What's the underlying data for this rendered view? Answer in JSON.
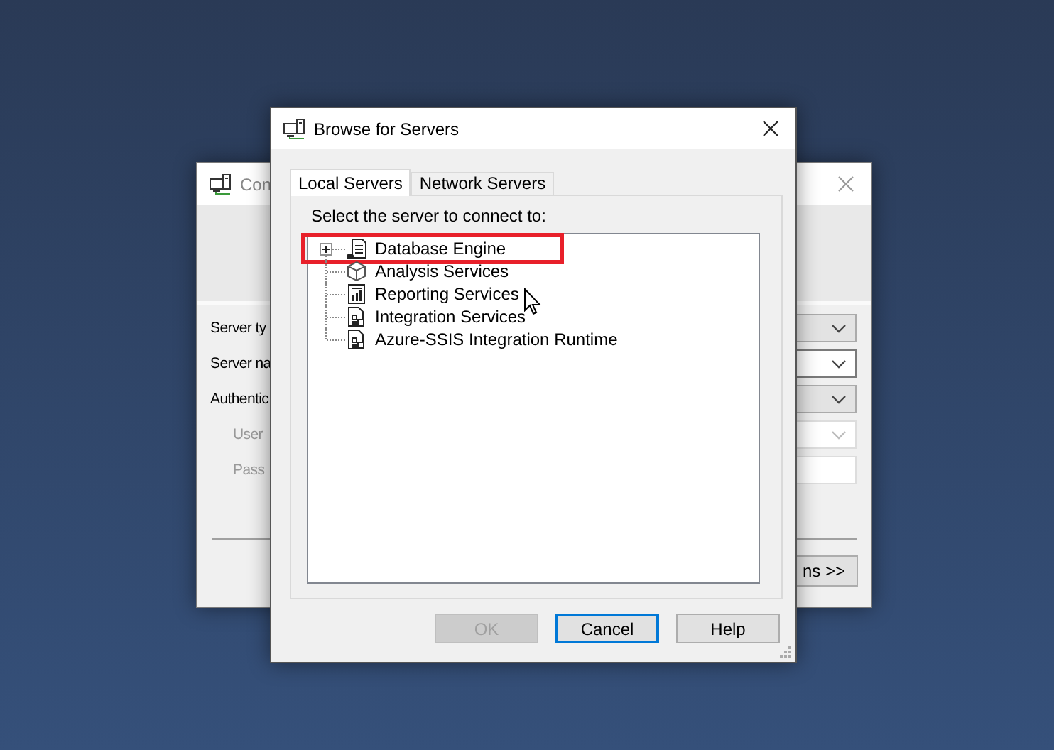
{
  "background_window": {
    "title": "Con",
    "labels": [
      {
        "text": "Server ty",
        "disabled": false
      },
      {
        "text": "Server na",
        "disabled": false
      },
      {
        "text": "Authentic",
        "disabled": false
      },
      {
        "text": "User",
        "disabled": true
      },
      {
        "text": "Pass",
        "disabled": true
      }
    ],
    "fields": [
      {
        "kind": "dropdown",
        "disabled": false
      },
      {
        "kind": "editable-dropdown",
        "disabled": false
      },
      {
        "kind": "dropdown",
        "disabled": false
      },
      {
        "kind": "editable-dropdown",
        "disabled": true
      },
      {
        "kind": "textbox",
        "disabled": true
      }
    ],
    "button": "ns >>"
  },
  "dialog": {
    "title": "Browse for Servers",
    "tabs": [
      {
        "label": "Local Servers",
        "selected": true
      },
      {
        "label": "Network Servers",
        "selected": false
      }
    ],
    "prompt": "Select the server to connect to:",
    "tree": [
      {
        "label": "Database Engine",
        "kind": "database",
        "expanded": false,
        "expandable": true,
        "highlighted": true
      },
      {
        "label": "Analysis Services",
        "kind": "cube",
        "expandable": false,
        "highlighted": false
      },
      {
        "label": "Reporting Services",
        "kind": "report",
        "expandable": false,
        "highlighted": false
      },
      {
        "label": "Integration Services",
        "kind": "package",
        "expandable": false,
        "highlighted": false
      },
      {
        "label": "Azure-SSIS Integration Runtime",
        "kind": "package",
        "expandable": false,
        "highlighted": false
      }
    ],
    "buttons": [
      {
        "label": "OK",
        "disabled": true,
        "focused": false
      },
      {
        "label": "Cancel",
        "disabled": false,
        "focused": true
      },
      {
        "label": "Help",
        "disabled": false,
        "focused": false
      }
    ]
  }
}
